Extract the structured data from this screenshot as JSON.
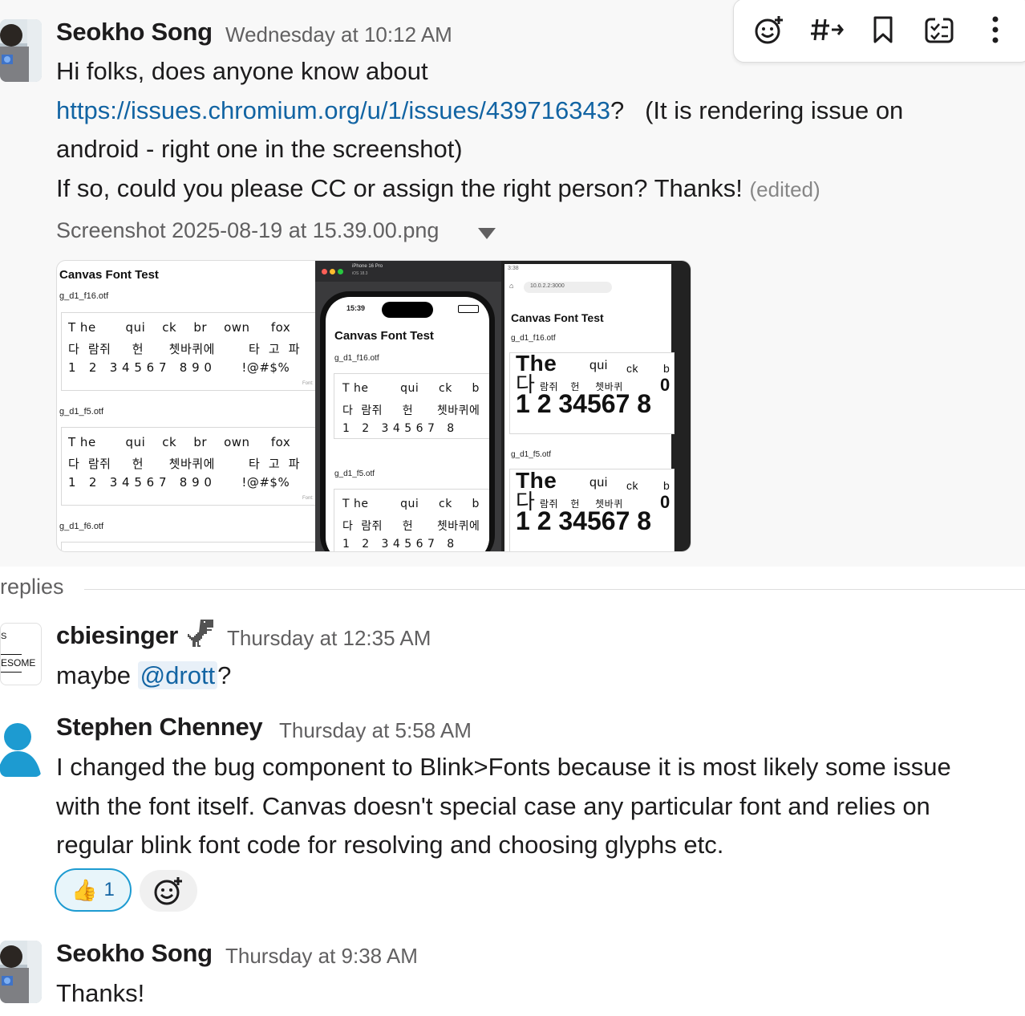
{
  "toolbar": {
    "icons": [
      "add-reaction-icon",
      "forward-to-channel-icon",
      "bookmark-icon",
      "create-task-icon",
      "more-options-icon"
    ]
  },
  "messages": [
    {
      "author": "Seokho Song",
      "timestamp": "Wednesday at 10:12 AM",
      "line1": "Hi folks, does anyone know about",
      "link": "https://issues.chromium.org/u/1/issues/439716343",
      "after_link": "?   (It is rendering issue on",
      "line3": "android - right one in the screenshot)",
      "line4": "If so, could you please CC or assign the right person? Thanks!",
      "edited": "(edited)",
      "file_name": "Screenshot 2025-08-19 at 15.39.00.png"
    }
  ],
  "screenshot": {
    "left_title": "Canvas Font Test",
    "font1": "g_d1_f16.otf",
    "font2": "g_d1_f5.otf",
    "font3": "g_d1_f6.otf",
    "row_en": "T he       qui    ck    br    own     fox",
    "row_ko": "다  람쥐     헌      쳇바퀴에        타  고  파",
    "row_num": "1   2   3 4 5 6 7   8 9 0       !@#$%",
    "font_label": "Font:",
    "sim_device": "iPhone 16 Pro",
    "sim_os": "iOS 18.3",
    "phone_time": "15:39",
    "phone_title": "Canvas Font Test",
    "phone_font1": "g_d1_f16.otf",
    "phone_font2": "g_d1_f5.otf",
    "phone_row_en": "T he        qui     ck     b",
    "phone_row_ko": "다  람쥐     헌      쳇바퀴에",
    "phone_row_num": "1   2   3 4 5 6 7   8",
    "android_status": "3:38",
    "android_url": "10.0.2.2:3000",
    "android_title": "Canvas Font Test",
    "android_font1": "g_d1_f16.otf",
    "android_font2": "g_d1_f5.otf",
    "android_big1": "The",
    "android_qui": "qui",
    "android_ck": "ck",
    "android_b": "b",
    "android_ko_big": "다",
    "android_ko_small": "람쥐    헌     쳇바퀴",
    "android_zero": "0",
    "android_nums": "1 2 34567 8"
  },
  "thread": {
    "replies_label": "replies",
    "replies": [
      {
        "author": "cbiesinger",
        "author_emoji": "dinosaur",
        "timestamp": "Thursday at 12:35 AM",
        "text_before": "maybe",
        "mention": "@drott",
        "text_after": "?",
        "avatar_text_1": "S",
        "avatar_text_2": "ESOME"
      },
      {
        "author": "Stephen Chenney",
        "timestamp": "Thursday at 5:58 AM",
        "line1": "I changed the bug component to Blink>Fonts because it is most likely some issue",
        "line2": "with the font itself. Canvas doesn't special case any particular font and relies on",
        "line3": "regular blink font code for resolving and choosing glyphs etc.",
        "reaction_emoji": "👍",
        "reaction_count": "1"
      },
      {
        "author": "Seokho Song",
        "timestamp": "Thursday at 9:38 AM",
        "text": "Thanks!"
      }
    ]
  }
}
